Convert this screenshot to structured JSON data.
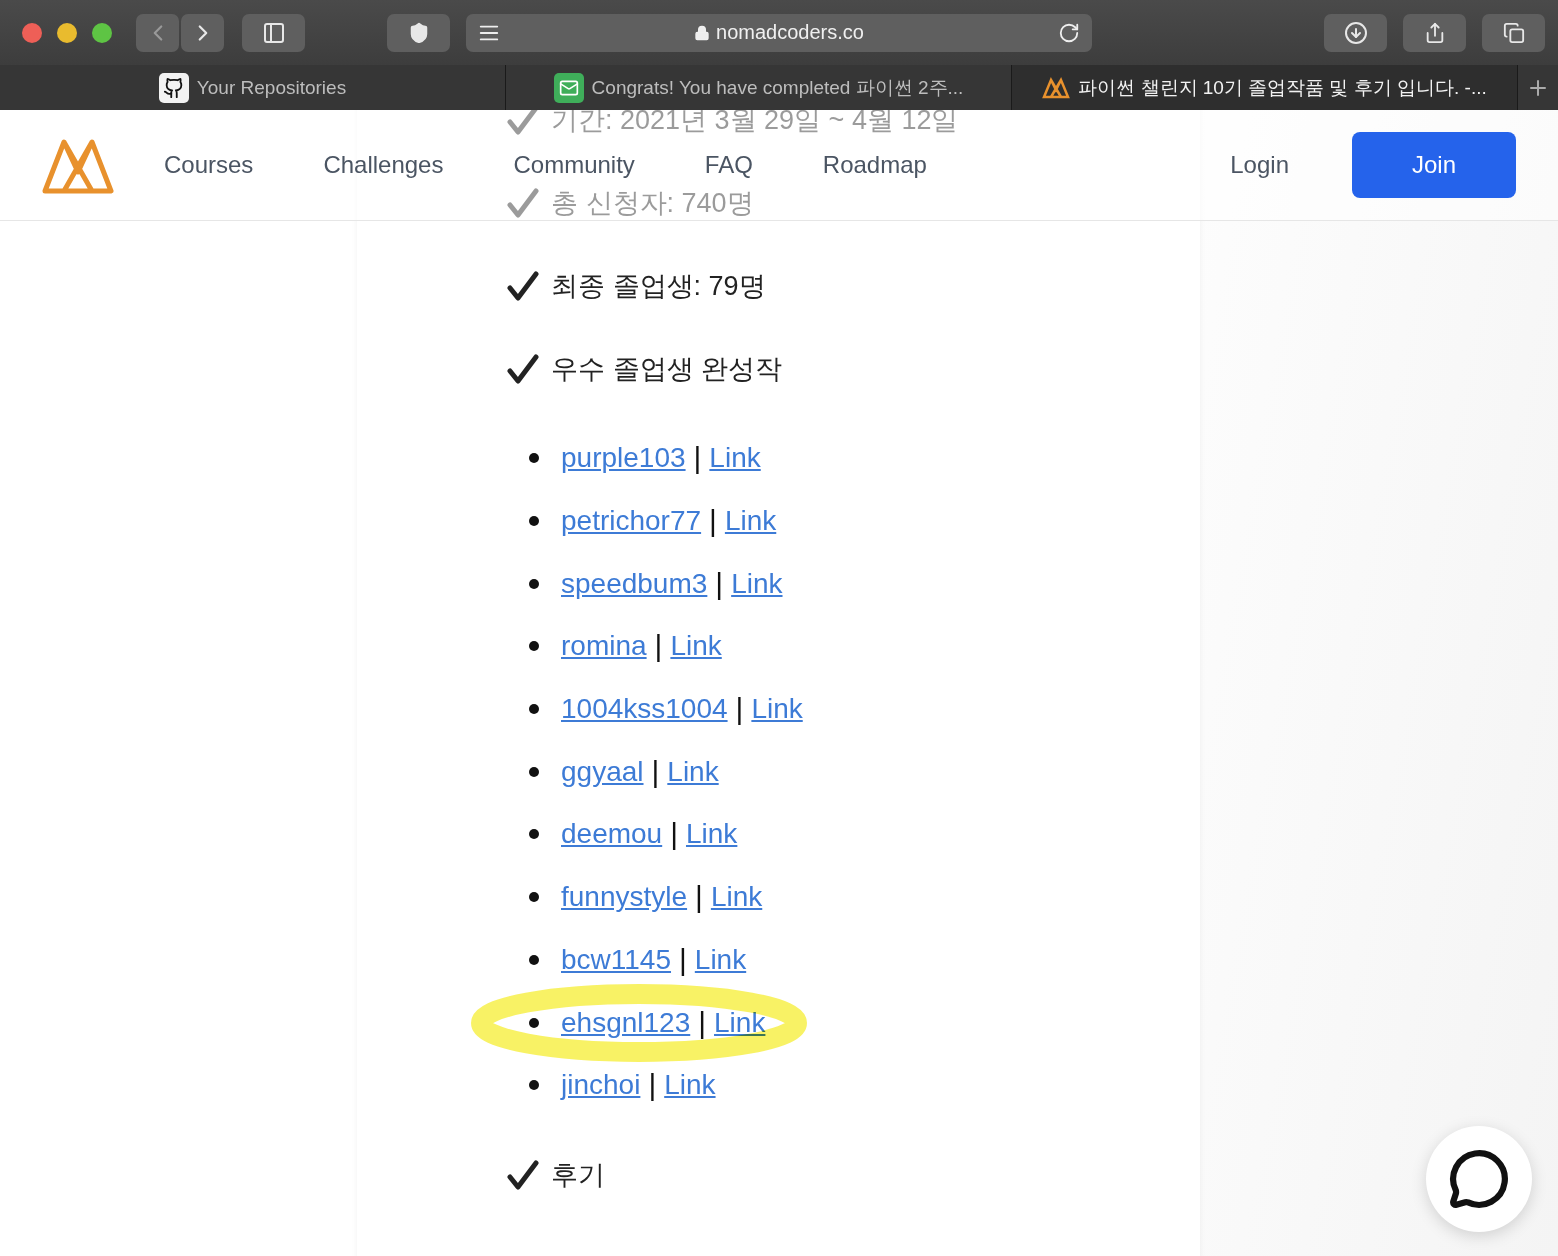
{
  "browser": {
    "url": "nomadcoders.co",
    "tabs": [
      {
        "title": "Your Repositories",
        "selected": false
      },
      {
        "title": "Congrats! You have completed 파이썬 2주...",
        "selected": false
      },
      {
        "title": "파이썬 챌린지 10기 졸업작품 및 후기 입니다. -...",
        "selected": true
      }
    ]
  },
  "nav": {
    "links": [
      "Courses",
      "Challenges",
      "Community",
      "FAQ",
      "Roadmap"
    ],
    "login": "Login",
    "join": "Join"
  },
  "article": {
    "sections": [
      {
        "text": "기간: 2021년 3월 29일 ~ 4월 12일"
      },
      {
        "text": "총 신청자: 740명"
      },
      {
        "text": "최종 졸업생: 79명"
      },
      {
        "text": "우수 졸업생 완성작",
        "items": [
          {
            "name": "purple103",
            "separator": "|",
            "link": "Link",
            "highlighted": false
          },
          {
            "name": "petrichor77",
            "separator": "|",
            "link": "Link",
            "highlighted": false
          },
          {
            "name": "speedbum3",
            "separator": "|",
            "link": "Link",
            "highlighted": false
          },
          {
            "name": "romina",
            "separator": "|",
            "link": "Link",
            "highlighted": false
          },
          {
            "name": "1004kss1004",
            "separator": "|",
            "link": "Link",
            "highlighted": false
          },
          {
            "name": "ggyaal",
            "separator": "|",
            "link": "Link",
            "highlighted": false
          },
          {
            "name": "deemou",
            "separator": "|",
            "link": "Link",
            "highlighted": false
          },
          {
            "name": "funnystyle",
            "separator": "|",
            "link": "Link",
            "highlighted": false
          },
          {
            "name": "bcw1145",
            "separator": "|",
            "link": "Link",
            "highlighted": false
          },
          {
            "name": "ehsgnl123",
            "separator": "|",
            "link": "Link",
            "highlighted": true
          },
          {
            "name": "jinchoi",
            "separator": "|",
            "link": "Link",
            "highlighted": false
          }
        ]
      },
      {
        "text": "후기"
      }
    ]
  }
}
